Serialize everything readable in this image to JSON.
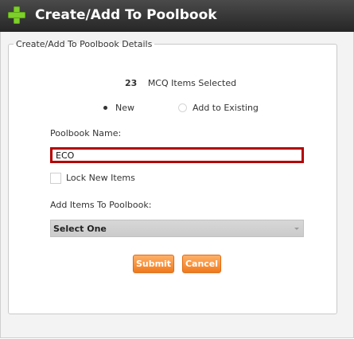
{
  "window": {
    "title": "Create/Add To Poolbook",
    "icon": "plus-icon",
    "accent_color": "#7fcf2c",
    "titlebar_color": "#333333"
  },
  "details": {
    "legend": "Create/Add To Poolbook Details",
    "items_count": "23",
    "items_selected_text": "MCQ Items Selected",
    "radio_new_label": "New",
    "radio_existing_label": "Add to Existing",
    "selected_option": "New",
    "poolbook_name_label": "Poolbook Name:",
    "poolbook_name_value": "ECO",
    "poolbook_name_border_color": "#b50000",
    "lock_items_label": "Lock New Items",
    "lock_items_checked": false,
    "add_items_label": "Add Items To Poolbook:",
    "add_items_selected": "Select One"
  },
  "actions": {
    "submit_label": "Submit",
    "cancel_label": "Cancel",
    "button_color": "#f07a1d"
  }
}
